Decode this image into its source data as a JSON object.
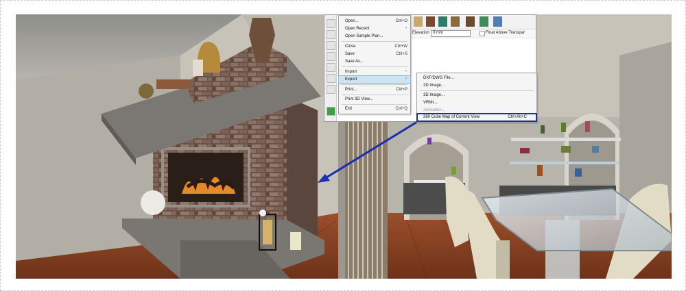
{
  "file_menu": {
    "items": [
      {
        "label": "Open...",
        "shortcut": "Ctrl+O"
      },
      {
        "label": "Open Recent",
        "submenu": true
      },
      {
        "label": "Open Sample Plan..."
      },
      {
        "label": "Close",
        "shortcut": "Ctrl+W"
      },
      {
        "label": "Save",
        "shortcut": "Ctrl+S"
      },
      {
        "label": "Save As..."
      },
      {
        "label": "Import",
        "submenu": true
      },
      {
        "label": "Export",
        "submenu": true,
        "highlighted": true
      },
      {
        "label": "Print...",
        "shortcut": "Ctrl+P"
      },
      {
        "label": "Print 3D View..."
      },
      {
        "label": "Exit",
        "shortcut": "Ctrl+Q"
      }
    ]
  },
  "export_submenu": {
    "items": [
      {
        "label": "DXF/DWG File..."
      },
      {
        "label": "2D Image..."
      },
      {
        "label": "3D Image..."
      },
      {
        "label": "VRML..."
      },
      {
        "label": "Animation...",
        "disabled": true
      },
      {
        "label": "360 Cube Map of Current View",
        "shortcut": "Ctrl+Alt+C",
        "boxed": true
      }
    ]
  },
  "toolbar": {
    "elevation_label": "Elevation",
    "elevation_value": "0 mm",
    "float_label": "Float Above Transpar"
  },
  "annotation": {
    "arrow_color": "#1b2fb3",
    "highlight_box_color": "#1b2f9b"
  },
  "colors": {
    "menu_highlight": "#cde4f7",
    "floor": "#8a4526",
    "wall": "#c7c2b8"
  }
}
